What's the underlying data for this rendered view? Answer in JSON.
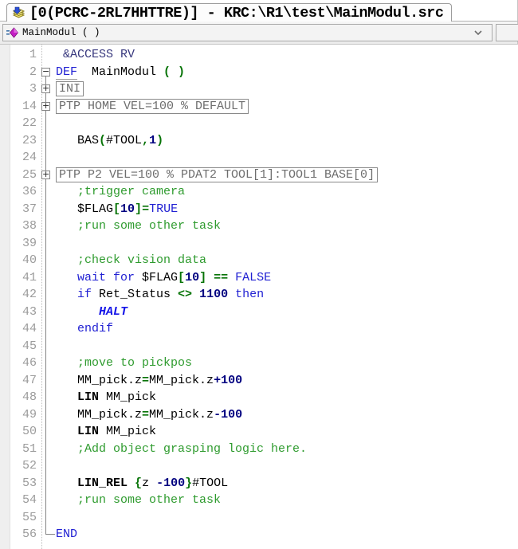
{
  "window": {
    "tab_title": "[0(PCRC-2RL7HHTTRE)] - KRC:\\R1\\test\\MainModul.src"
  },
  "selector": {
    "value": "MainModul ( )"
  },
  "colors": {
    "keyword": "#2121d3",
    "operator": "#067306",
    "number": "#000080",
    "comment": "#2e9b2e",
    "halt": "#1414e8",
    "access": "#39397e",
    "fold_gray": "#6e6e6e",
    "line_number": "#9b9b9b",
    "fold_line": "#848484",
    "bar_bg": "#f0f0f0",
    "editor_bg": "#ffffff"
  },
  "editor": {
    "lines": [
      {
        "num": "1",
        "fold": "none",
        "segments": [
          [
            "a",
            " &ACCESS RV"
          ]
        ]
      },
      {
        "num": "2",
        "fold": "start",
        "segments": [
          [
            "kd",
            "DEF"
          ],
          [
            "t",
            "  MainModul "
          ],
          [
            "p",
            "( )"
          ]
        ]
      },
      {
        "num": "3",
        "fold": "plus",
        "boxed": true,
        "segments": [
          [
            "g",
            "INI"
          ]
        ]
      },
      {
        "num": "14",
        "fold": "plus",
        "boxed": true,
        "segments": [
          [
            "g",
            "PTP HOME VEL=100 % DEFAULT"
          ]
        ]
      },
      {
        "num": "22",
        "fold": "line",
        "segments": []
      },
      {
        "num": "23",
        "fold": "line",
        "segments": [
          [
            "t",
            "   BAS"
          ],
          [
            "p",
            "("
          ],
          [
            "t",
            "#TOOL"
          ],
          [
            "p",
            ","
          ],
          [
            "n",
            "1"
          ],
          [
            "p",
            ")"
          ]
        ]
      },
      {
        "num": "24",
        "fold": "line",
        "segments": []
      },
      {
        "num": "25",
        "fold": "plus",
        "boxed": true,
        "segments": [
          [
            "g",
            "PTP P2 VEL=100 % PDAT2 TOOL[1]:TOOL1 BASE[0]"
          ]
        ]
      },
      {
        "num": "36",
        "fold": "line",
        "segments": [
          [
            "c",
            "   ;trigger camera"
          ]
        ]
      },
      {
        "num": "37",
        "fold": "line",
        "segments": [
          [
            "t",
            "   $FLAG"
          ],
          [
            "p",
            "["
          ],
          [
            "n",
            "10"
          ],
          [
            "p",
            "]"
          ],
          [
            "p",
            "="
          ],
          [
            "k",
            "TRUE"
          ]
        ]
      },
      {
        "num": "38",
        "fold": "line",
        "segments": [
          [
            "c",
            "   ;run some other task"
          ]
        ]
      },
      {
        "num": "39",
        "fold": "line",
        "segments": []
      },
      {
        "num": "40",
        "fold": "line",
        "segments": [
          [
            "c",
            "   ;check vision data"
          ]
        ]
      },
      {
        "num": "41",
        "fold": "line",
        "segments": [
          [
            "k",
            "   wait for "
          ],
          [
            "t",
            "$FLAG"
          ],
          [
            "p",
            "["
          ],
          [
            "n",
            "10"
          ],
          [
            "p",
            "]"
          ],
          [
            "t",
            " "
          ],
          [
            "p",
            "=="
          ],
          [
            "t",
            " "
          ],
          [
            "k",
            "FALSE"
          ]
        ]
      },
      {
        "num": "42",
        "fold": "line",
        "segments": [
          [
            "k",
            "   if "
          ],
          [
            "t",
            "Ret_Status "
          ],
          [
            "p",
            "<>"
          ],
          [
            "t",
            " "
          ],
          [
            "n",
            "1100"
          ],
          [
            "t",
            " "
          ],
          [
            "k",
            "then"
          ]
        ]
      },
      {
        "num": "43",
        "fold": "line",
        "segments": [
          [
            "t",
            "      "
          ],
          [
            "h",
            "HALT"
          ]
        ]
      },
      {
        "num": "44",
        "fold": "line",
        "segments": [
          [
            "k",
            "   endif"
          ]
        ]
      },
      {
        "num": "45",
        "fold": "line",
        "segments": []
      },
      {
        "num": "46",
        "fold": "line",
        "segments": [
          [
            "c",
            "   ;move to pickpos"
          ]
        ]
      },
      {
        "num": "47",
        "fold": "line",
        "segments": [
          [
            "t",
            "   MM_pick.z"
          ],
          [
            "p",
            "="
          ],
          [
            "t",
            "MM_pick.z"
          ],
          [
            "n",
            "+100"
          ]
        ]
      },
      {
        "num": "48",
        "fold": "line",
        "segments": [
          [
            "t",
            "   "
          ],
          [
            "b",
            "LIN"
          ],
          [
            "t",
            " MM_pick"
          ]
        ]
      },
      {
        "num": "49",
        "fold": "line",
        "segments": [
          [
            "t",
            "   MM_pick.z"
          ],
          [
            "p",
            "="
          ],
          [
            "t",
            "MM_pick.z"
          ],
          [
            "n",
            "-100"
          ]
        ]
      },
      {
        "num": "50",
        "fold": "line",
        "segments": [
          [
            "t",
            "   "
          ],
          [
            "b",
            "LIN"
          ],
          [
            "t",
            " MM_pick"
          ]
        ]
      },
      {
        "num": "51",
        "fold": "line",
        "segments": [
          [
            "c",
            "   ;Add object grasping logic here."
          ]
        ]
      },
      {
        "num": "52",
        "fold": "line",
        "segments": []
      },
      {
        "num": "53",
        "fold": "line",
        "segments": [
          [
            "t",
            "   "
          ],
          [
            "b",
            "LIN_REL"
          ],
          [
            "t",
            " "
          ],
          [
            "p",
            "{"
          ],
          [
            "t",
            "z "
          ],
          [
            "n",
            "-100"
          ],
          [
            "p",
            "}"
          ],
          [
            "t",
            "#TOOL"
          ]
        ]
      },
      {
        "num": "54",
        "fold": "line",
        "segments": [
          [
            "c",
            "   ;run some other task"
          ]
        ]
      },
      {
        "num": "55",
        "fold": "line",
        "segments": []
      },
      {
        "num": "56",
        "fold": "end",
        "segments": [
          [
            "k",
            "END"
          ]
        ]
      }
    ]
  }
}
